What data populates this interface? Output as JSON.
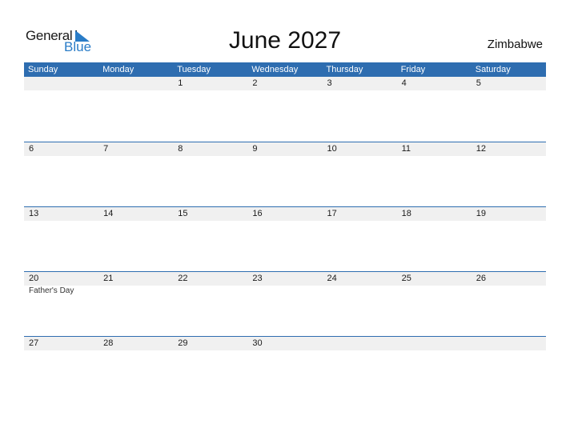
{
  "logo": {
    "line1": "General",
    "line2": "Blue"
  },
  "title": "June 2027",
  "country": "Zimbabwe",
  "colors": {
    "accent": "#2e6db0",
    "band": "#f0f0f0",
    "logo_blue": "#2a7cc7"
  },
  "weekdays": [
    "Sunday",
    "Monday",
    "Tuesday",
    "Wednesday",
    "Thursday",
    "Friday",
    "Saturday"
  ],
  "weeks": [
    {
      "days": [
        {
          "num": "",
          "event": ""
        },
        {
          "num": "",
          "event": ""
        },
        {
          "num": "1",
          "event": ""
        },
        {
          "num": "2",
          "event": ""
        },
        {
          "num": "3",
          "event": ""
        },
        {
          "num": "4",
          "event": ""
        },
        {
          "num": "5",
          "event": ""
        }
      ]
    },
    {
      "days": [
        {
          "num": "6",
          "event": ""
        },
        {
          "num": "7",
          "event": ""
        },
        {
          "num": "8",
          "event": ""
        },
        {
          "num": "9",
          "event": ""
        },
        {
          "num": "10",
          "event": ""
        },
        {
          "num": "11",
          "event": ""
        },
        {
          "num": "12",
          "event": ""
        }
      ]
    },
    {
      "days": [
        {
          "num": "13",
          "event": ""
        },
        {
          "num": "14",
          "event": ""
        },
        {
          "num": "15",
          "event": ""
        },
        {
          "num": "16",
          "event": ""
        },
        {
          "num": "17",
          "event": ""
        },
        {
          "num": "18",
          "event": ""
        },
        {
          "num": "19",
          "event": ""
        }
      ]
    },
    {
      "days": [
        {
          "num": "20",
          "event": "Father's Day"
        },
        {
          "num": "21",
          "event": ""
        },
        {
          "num": "22",
          "event": ""
        },
        {
          "num": "23",
          "event": ""
        },
        {
          "num": "24",
          "event": ""
        },
        {
          "num": "25",
          "event": ""
        },
        {
          "num": "26",
          "event": ""
        }
      ]
    },
    {
      "days": [
        {
          "num": "27",
          "event": ""
        },
        {
          "num": "28",
          "event": ""
        },
        {
          "num": "29",
          "event": ""
        },
        {
          "num": "30",
          "event": ""
        },
        {
          "num": "",
          "event": ""
        },
        {
          "num": "",
          "event": ""
        },
        {
          "num": "",
          "event": ""
        }
      ]
    }
  ]
}
